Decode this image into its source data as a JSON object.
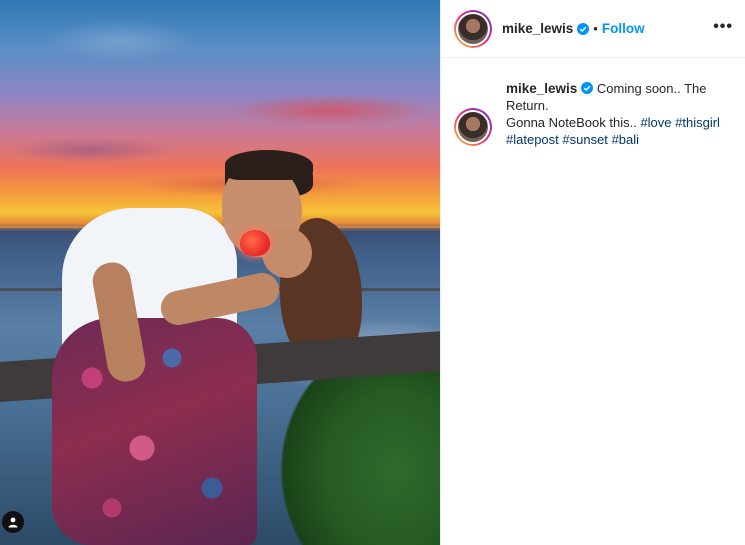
{
  "post": {
    "photo_alt": "photo",
    "username": "mike_lewis",
    "separator": "•",
    "follow_label": "Follow",
    "more_label": "•••",
    "caption": {
      "line1": "Coming soon.. The",
      "line2": "Return.",
      "line3": "Gonna NoteBook this..",
      "hashtags": [
        "#love",
        "#thisgirl",
        "#latepost",
        "#sunset",
        "#bali"
      ]
    }
  },
  "colors": {
    "follow": "#0095f6",
    "hashtag": "#00376b",
    "verified": "#0095f6"
  },
  "icons": {
    "verified": "verified-badge-icon",
    "more": "more-options-icon",
    "tag": "user-tag-icon"
  }
}
